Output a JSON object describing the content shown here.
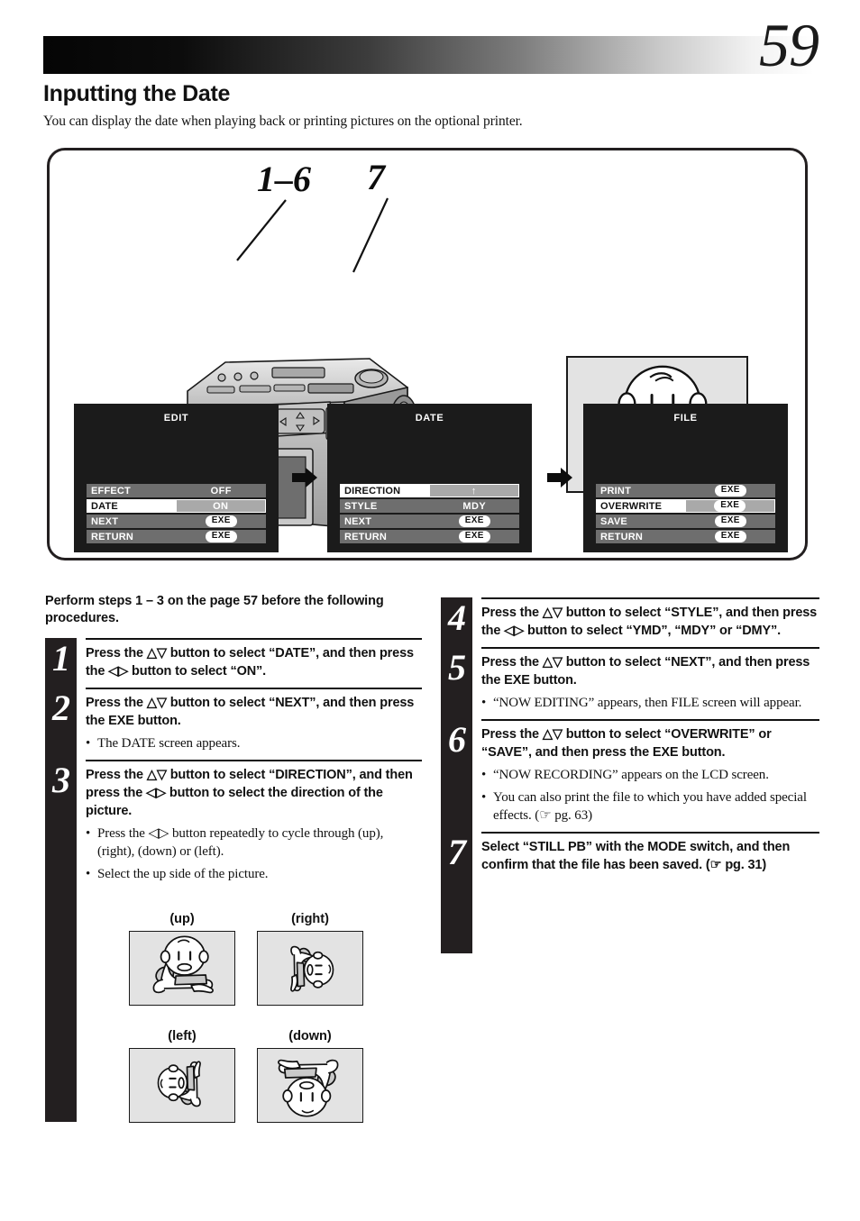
{
  "page": {
    "number": "59",
    "title": "Inputting the Date",
    "subtitle": "You can display the date when playing back or printing pictures on the optional printer."
  },
  "illustration": {
    "callout_steps": "1–6",
    "callout_mode": "7",
    "camera_name": "digital-camera",
    "sample_photo_caption": "baby-photo-sample"
  },
  "menus": [
    {
      "id": "edit",
      "title": "EDIT",
      "rows": [
        {
          "label": "EFFECT",
          "value": "OFF",
          "type": "text",
          "selected": false
        },
        {
          "label": "DATE",
          "value": "ON",
          "type": "text",
          "selected": true
        },
        {
          "label": "NEXT",
          "value": "EXE",
          "type": "exe",
          "selected": false
        },
        {
          "label": "RETURN",
          "value": "EXE",
          "type": "exe",
          "selected": false
        }
      ]
    },
    {
      "id": "date",
      "title": "DATE",
      "rows": [
        {
          "label": "DIRECTION",
          "value": "↑",
          "type": "text",
          "selected": true
        },
        {
          "label": "STYLE",
          "value": "MDY",
          "type": "text",
          "selected": false
        },
        {
          "label": "NEXT",
          "value": "EXE",
          "type": "exe",
          "selected": false
        },
        {
          "label": "RETURN",
          "value": "EXE",
          "type": "exe",
          "selected": false
        }
      ]
    },
    {
      "id": "file",
      "title": "FILE",
      "rows": [
        {
          "label": "PRINT",
          "value": "EXE",
          "type": "exe",
          "selected": false
        },
        {
          "label": "OVERWRITE",
          "value": "EXE",
          "type": "exe",
          "selected": true
        },
        {
          "label": "SAVE",
          "value": "EXE",
          "type": "exe",
          "selected": false
        },
        {
          "label": "RETURN",
          "value": "EXE",
          "type": "exe",
          "selected": false
        }
      ]
    }
  ],
  "steps_intro": "Perform steps 1 – 3 on the page 57 before the following procedures.",
  "steps": [
    {
      "num": "1",
      "main": "Press the △▽ button to select “DATE”, and then press the ◁▷ button to select “ON”.",
      "notes": []
    },
    {
      "num": "2",
      "main": "Press the △▽ button to select “NEXT”, and then press the EXE button.",
      "notes": [
        "The DATE screen appears."
      ]
    },
    {
      "num": "3",
      "main": "Press the △▽ button to select “DIRECTION”, and then press the ◁▷ button to select the direction of the picture.",
      "notes": [
        "Press the ◁▷ button repeatedly to cycle through   (up),   (right),   (down) or   (left).",
        "Select the up side of the picture."
      ]
    },
    {
      "num": "4",
      "main": "Press the △▽ button to select “STYLE”, and then press the ◁▷ button to select “YMD”, “MDY” or “DMY”.",
      "notes": []
    },
    {
      "num": "5",
      "main": "Press the △▽ button to select “NEXT”, and then press the EXE button.",
      "notes": [
        "“NOW EDITING” appears, then FILE screen will appear."
      ]
    },
    {
      "num": "6",
      "main": "Press the △▽ button to select “OVERWRITE” or “SAVE”, and then press the EXE button.",
      "notes": [
        "“NOW RECORDING” appears on the LCD screen.",
        "You can also print the file to which you have added special effects. (☞ pg. 63)"
      ]
    },
    {
      "num": "7",
      "main": "Select “STILL PB” with the MODE switch, and then confirm that the file has been saved. (☞ pg. 31)",
      "notes": []
    }
  ],
  "orientations": [
    {
      "id": "up",
      "caption": "(up)"
    },
    {
      "id": "right",
      "caption": "(right)"
    },
    {
      "id": "left",
      "caption": "(left)"
    },
    {
      "id": "down",
      "caption": "(down)"
    }
  ],
  "colors": {
    "ink": "#231f20",
    "menu_background": "#1b1b1b",
    "menu_row": "#6e6e6e",
    "menu_row_selected_label": "#ffffff",
    "menu_row_selected_value": "#a9a9a9",
    "photo_background": "#e3e3e3"
  }
}
